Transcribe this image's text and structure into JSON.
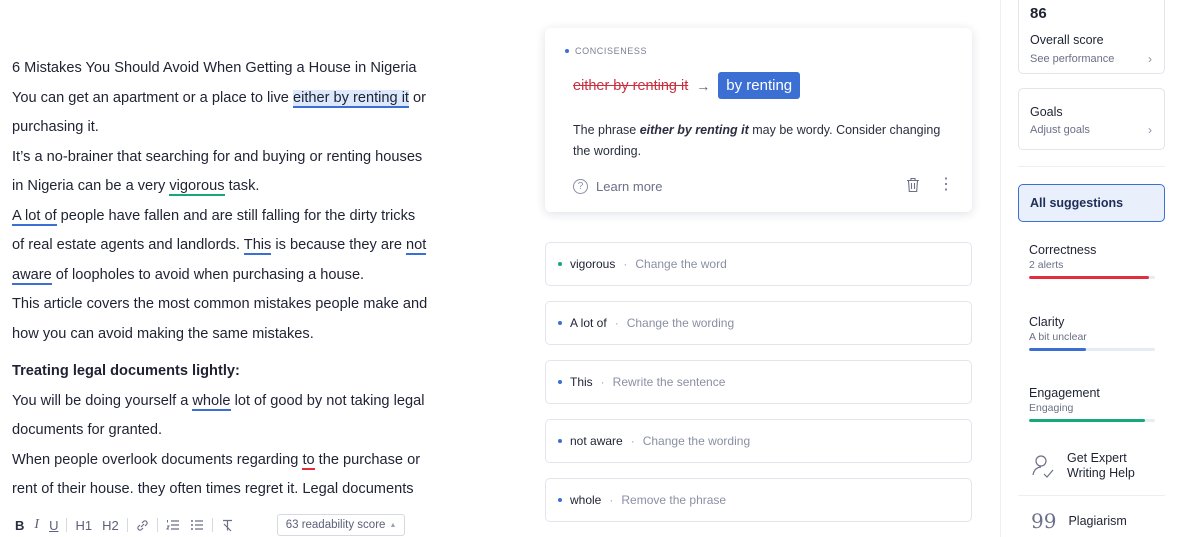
{
  "editor": {
    "line1": "6 Mistakes You Should Avoid When Getting a House in Nigeria",
    "line2a": "You can get an apartment or a place to live ",
    "line2b": "either by renting it",
    "line2c": " or",
    "line3": "purchasing it.",
    "line4": "It’s a no-brainer that searching for and buying or renting houses",
    "line5a": "in Nigeria can be a very ",
    "line5b": "vigorous",
    "line5c": " task.",
    "line6a": "A lot of",
    "line6b": " people have fallen and are still falling for the dirty tricks",
    "line7a": "of real estate agents and landlords. ",
    "line7b": "This",
    "line7c": " is because they are ",
    "line7d": "not",
    "line8a": "aware",
    "line8b": " of loopholes to avoid when purchasing a house.",
    "line9": "This article covers the most common mistakes people make and",
    "line10": "how you can avoid making the same mistakes.",
    "heading": "Treating legal documents lightly:",
    "line11a": "You will be doing yourself a ",
    "line11b": "whole",
    "line11c": " lot of good by not taking legal",
    "line12": "documents for granted.",
    "line13a": "When people overlook documents regarding ",
    "line13b": "to",
    "line13c": " the purchase or",
    "line14": "rent of their house. they often times regret it. Legal documents"
  },
  "toolbar": {
    "bold": "B",
    "italic": "I",
    "underline": "U",
    "h1": "H1",
    "h2": "H2",
    "readability": "63 readability score"
  },
  "main_suggestion": {
    "category": "CONCISENESS",
    "original": "either by renting it",
    "arrow": "→",
    "replacement": "by renting",
    "explain_a": "The phrase ",
    "explain_b": "either by renting it",
    "explain_c": " may be wordy. Consider changing the wording.",
    "learn_more": "Learn more"
  },
  "suggestions": [
    {
      "word": "vigorous",
      "hint": "Change the word",
      "color": "#16a77a"
    },
    {
      "word": "A lot of",
      "hint": "Change the wording",
      "color": "#3b6fd4"
    },
    {
      "word": "This",
      "hint": "Rewrite the sentence",
      "color": "#3b6fd4"
    },
    {
      "word": "not aware",
      "hint": "Change the wording",
      "color": "#3b6fd4"
    },
    {
      "word": "whole",
      "hint": "Remove the phrase",
      "color": "#3b6fd4"
    }
  ],
  "sidebar": {
    "score": "86",
    "score_label": "Overall score",
    "score_link": "See performance",
    "goals": "Goals",
    "goals_link": "Adjust goals",
    "all_suggestions": "All suggestions",
    "correctness": "Correctness",
    "correctness_sub": "2 alerts",
    "correctness_color": "#e22d3f",
    "correctness_level": 0.95,
    "clarity": "Clarity",
    "clarity_sub": "A bit unclear",
    "clarity_color": "#3b6fd4",
    "clarity_level": 0.45,
    "engagement": "Engagement",
    "engagement_sub": "Engaging",
    "engagement_color": "#16a77a",
    "engagement_level": 0.92,
    "expert": "Get Expert Writing Help",
    "plagiarism": "Plagiarism"
  }
}
